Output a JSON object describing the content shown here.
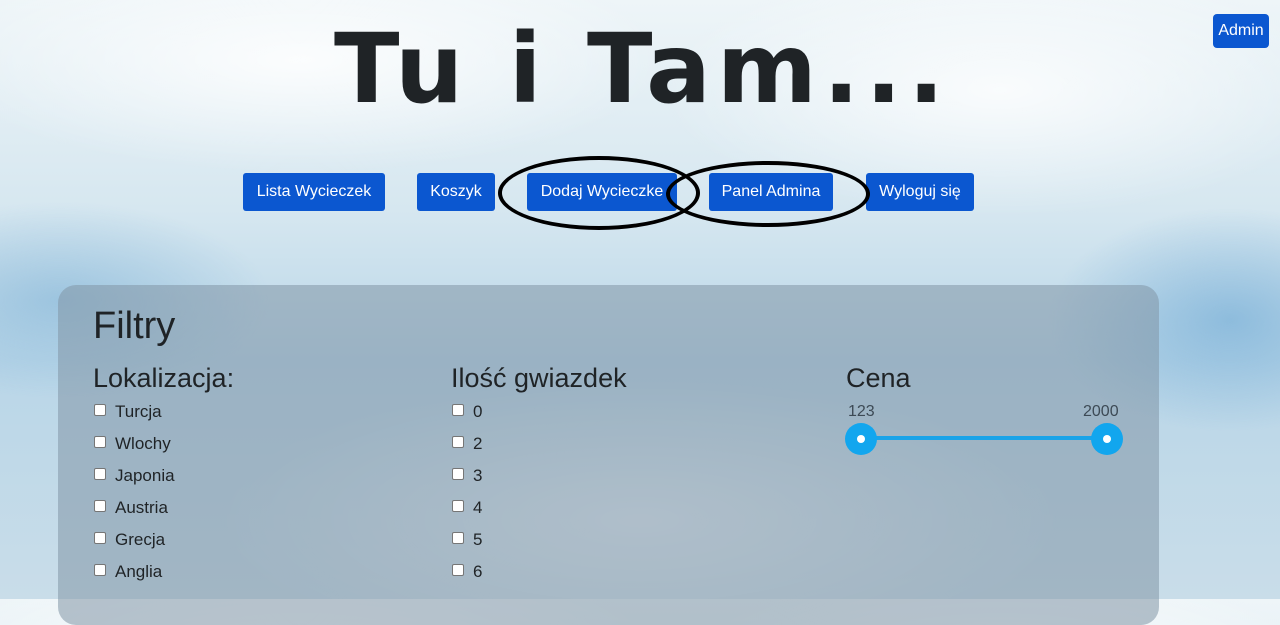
{
  "header": {
    "logo_text": "Tu i Tam...",
    "admin_label": "Admin"
  },
  "nav": [
    {
      "label": "Lista Wycieczek"
    },
    {
      "label": "Koszyk"
    },
    {
      "label": "Dodaj Wycieczke"
    },
    {
      "label": "Panel Admina"
    },
    {
      "label": "Wyloguj się"
    }
  ],
  "filters": {
    "title": "Filtry",
    "location": {
      "title": "Lokalizacja:",
      "options": [
        "Turcja",
        "Wlochy",
        "Japonia",
        "Austria",
        "Grecja",
        "Anglia"
      ]
    },
    "stars": {
      "title": "Ilość gwiazdek",
      "options": [
        "0",
        "2",
        "3",
        "4",
        "5",
        "6"
      ]
    },
    "price": {
      "title": "Cena",
      "min": "123",
      "max": "2000"
    }
  },
  "colors": {
    "button": "#0b57d0",
    "slider": "#12a6ee",
    "annotation": "#000000"
  }
}
